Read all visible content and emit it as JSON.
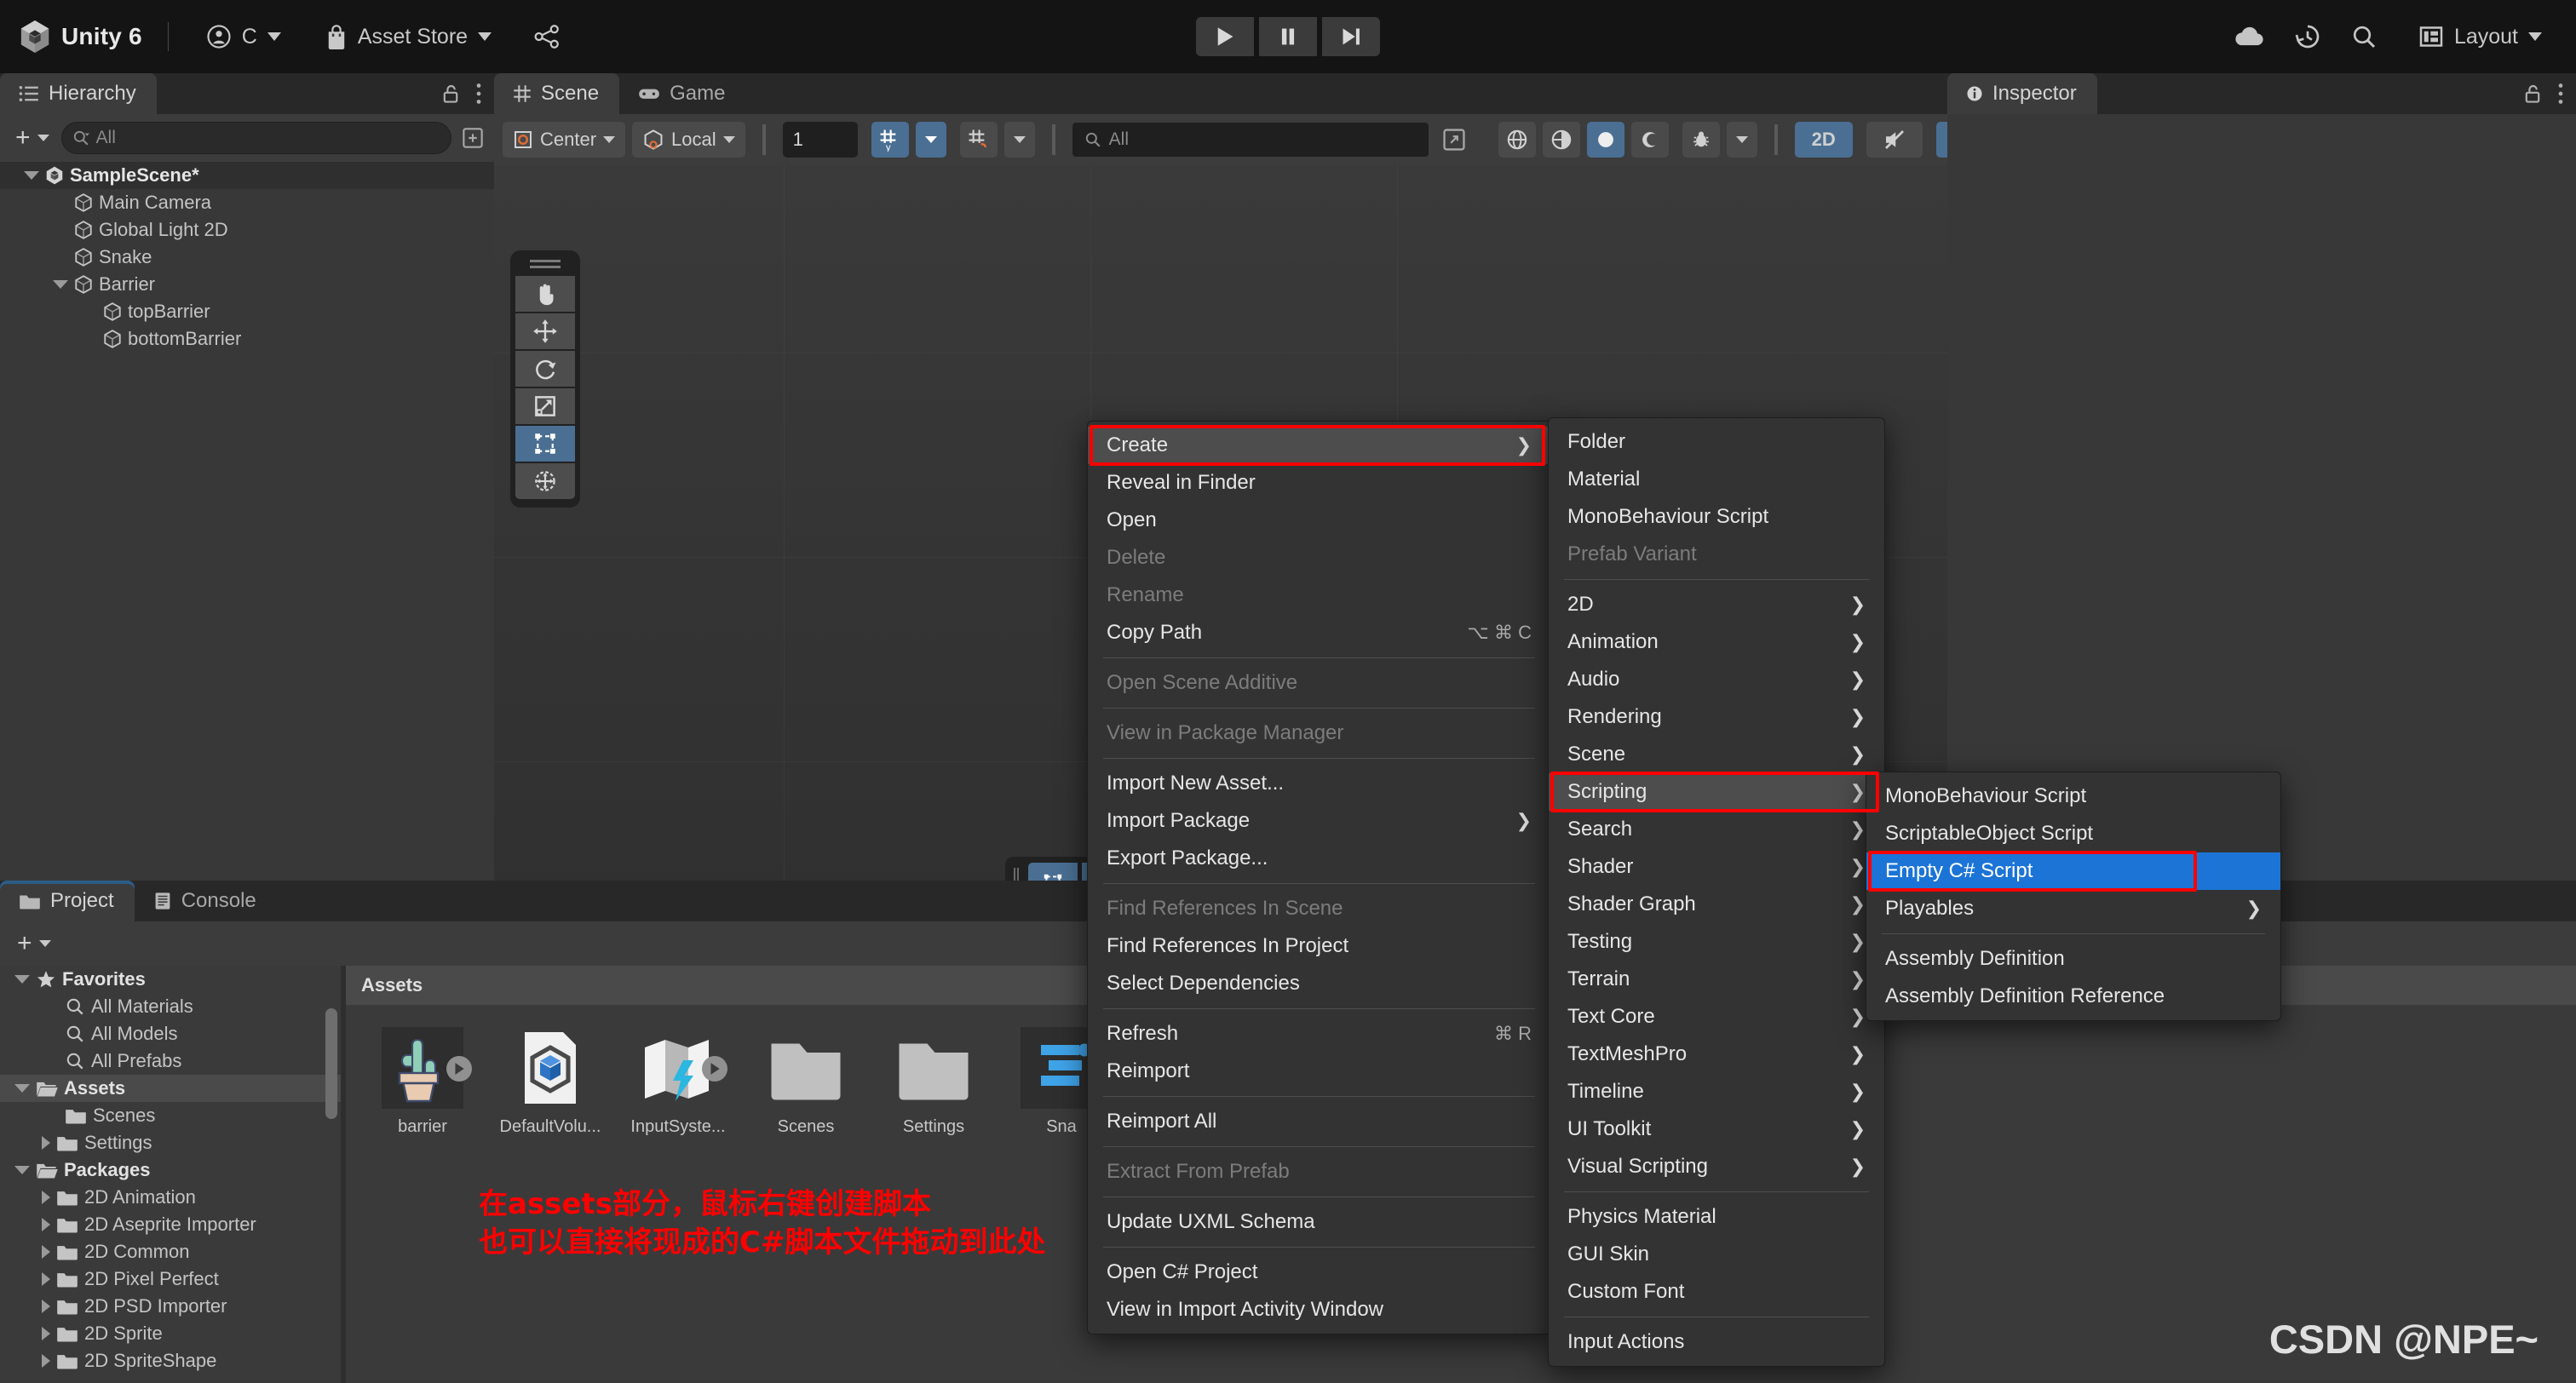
{
  "topbar": {
    "app_title": "Unity 6",
    "account_label": "C",
    "asset_store_label": "Asset Store",
    "icons": {
      "unity_logo": "unity-logo-icon",
      "account": "account-circle-icon",
      "asset_store": "shopping-bag-icon",
      "collab": "version-control-icon",
      "cloud": "cloud-icon",
      "history": "history-clock-icon",
      "search": "search-icon",
      "layout": "layout-grid-icon"
    },
    "play_controls": [
      "play-icon",
      "pause-icon",
      "step-icon"
    ],
    "layout_label": "Layout"
  },
  "hierarchy": {
    "tab_label": "Hierarchy",
    "add_label": "+",
    "search_placeholder": "All",
    "items": [
      {
        "label": "SampleScene*",
        "depth": 0,
        "expanded": true,
        "icon": "unity-scene-icon",
        "selected": true
      },
      {
        "label": "Main Camera",
        "depth": 1,
        "expanded": null,
        "icon": "gameobject-icon",
        "selected": false
      },
      {
        "label": "Global Light 2D",
        "depth": 1,
        "expanded": null,
        "icon": "gameobject-icon",
        "selected": false
      },
      {
        "label": "Snake",
        "depth": 1,
        "expanded": null,
        "icon": "gameobject-icon",
        "selected": false
      },
      {
        "label": "Barrier",
        "depth": 1,
        "expanded": true,
        "icon": "gameobject-icon",
        "selected": false
      },
      {
        "label": "topBarrier",
        "depth": 2,
        "expanded": null,
        "icon": "gameobject-icon",
        "selected": false
      },
      {
        "label": "bottomBarrier",
        "depth": 2,
        "expanded": null,
        "icon": "gameobject-icon",
        "selected": false
      }
    ]
  },
  "sceneview": {
    "tabs": [
      {
        "label": "Scene",
        "icon": "grid-hash-icon",
        "active": true
      },
      {
        "label": "Game",
        "icon": "gamepad-icon",
        "active": false
      }
    ],
    "toolbar": {
      "pivot_label": "Center",
      "space_label": "Local",
      "grid_size_value": "1",
      "search_placeholder": "All",
      "twod_label": "2D",
      "grid_snap_icon": "grid-snap-icon",
      "snap_increment_icon": "snap-increment-icon",
      "gizmos_icon": "gizmos-icon"
    },
    "tools": [
      {
        "name": "hand-tool",
        "selected": false
      },
      {
        "name": "move-tool",
        "selected": false
      },
      {
        "name": "rotate-tool",
        "selected": false
      },
      {
        "name": "scale-tool",
        "selected": false
      },
      {
        "name": "rect-tool",
        "selected": true
      },
      {
        "name": "transform-tool",
        "selected": false
      }
    ],
    "bottom_bar": [
      {
        "name": "rect-overlay",
        "selected": true
      },
      {
        "name": "tool-settings",
        "selected": true
      },
      {
        "name": "grid-visibility",
        "selected": false
      },
      {
        "name": "scene-material",
        "selected": false
      },
      {
        "name": "layers-overlay",
        "selected": true
      },
      {
        "name": "search-overlay",
        "selected": false
      },
      {
        "name": "camera-overlay",
        "selected": false
      },
      {
        "name": "shuffle-overlay",
        "selected": false
      }
    ]
  },
  "inspector": {
    "tab_label": "Inspector",
    "icons": {
      "info": "info-circle-icon",
      "lock": "lock-open-icon",
      "menu": "kebab-menu-icon"
    }
  },
  "project": {
    "tabs": [
      {
        "label": "Project",
        "icon": "folder-icon",
        "active": true
      },
      {
        "label": "Console",
        "icon": "console-icon",
        "active": false
      }
    ],
    "add_label": "+",
    "tree": [
      {
        "label": "Favorites",
        "depth": 0,
        "expand": "down",
        "icon": "star-icon",
        "bold": true,
        "selected": false
      },
      {
        "label": "All Materials",
        "depth": 1,
        "expand": null,
        "icon": "search-icon",
        "bold": false,
        "selected": false
      },
      {
        "label": "All Models",
        "depth": 1,
        "expand": null,
        "icon": "search-icon",
        "bold": false,
        "selected": false
      },
      {
        "label": "All Prefabs",
        "depth": 1,
        "expand": null,
        "icon": "search-icon",
        "bold": false,
        "selected": false
      },
      {
        "label": "Assets",
        "depth": 0,
        "expand": "down",
        "icon": "folder-open-icon",
        "bold": true,
        "selected": true
      },
      {
        "label": "Scenes",
        "depth": 1,
        "expand": null,
        "icon": "folder-icon",
        "bold": false,
        "selected": false
      },
      {
        "label": "Settings",
        "depth": 1,
        "expand": "right",
        "icon": "folder-icon",
        "bold": false,
        "selected": false
      },
      {
        "label": "Packages",
        "depth": 0,
        "expand": "down",
        "icon": "folder-open-icon",
        "bold": true,
        "selected": false
      },
      {
        "label": "2D Animation",
        "depth": 1,
        "expand": "right",
        "icon": "folder-icon",
        "bold": false,
        "selected": false
      },
      {
        "label": "2D Aseprite Importer",
        "depth": 1,
        "expand": "right",
        "icon": "folder-icon",
        "bold": false,
        "selected": false
      },
      {
        "label": "2D Common",
        "depth": 1,
        "expand": "right",
        "icon": "folder-icon",
        "bold": false,
        "selected": false
      },
      {
        "label": "2D Pixel Perfect",
        "depth": 1,
        "expand": "right",
        "icon": "folder-icon",
        "bold": false,
        "selected": false
      },
      {
        "label": "2D PSD Importer",
        "depth": 1,
        "expand": "right",
        "icon": "folder-icon",
        "bold": false,
        "selected": false
      },
      {
        "label": "2D Sprite",
        "depth": 1,
        "expand": "right",
        "icon": "folder-icon",
        "bold": false,
        "selected": false
      },
      {
        "label": "2D SpriteShape",
        "depth": 1,
        "expand": "right",
        "icon": "folder-icon",
        "bold": false,
        "selected": false
      }
    ],
    "breadcrumb": "Assets",
    "assets": [
      {
        "label": "barrier",
        "icon": "cactus-sprite-icon",
        "has_play": true
      },
      {
        "label": "DefaultVolu...",
        "icon": "volume-profile-icon",
        "has_play": false
      },
      {
        "label": "InputSyste...",
        "icon": "input-actions-icon",
        "has_play": true
      },
      {
        "label": "Scenes",
        "icon": "folder-icon",
        "has_play": false
      },
      {
        "label": "Settings",
        "icon": "folder-icon",
        "has_play": false
      },
      {
        "label": "Sna",
        "icon": "snake-sprite-icon",
        "has_play": false
      }
    ]
  },
  "context_menu": {
    "items": [
      {
        "label": "Create",
        "state": "highlight",
        "submenu": true,
        "shortcut": "",
        "redbox": true
      },
      {
        "label": "Reveal in Finder",
        "state": "normal",
        "submenu": false,
        "shortcut": ""
      },
      {
        "label": "Open",
        "state": "normal",
        "submenu": false,
        "shortcut": ""
      },
      {
        "label": "Delete",
        "state": "disabled",
        "submenu": false,
        "shortcut": ""
      },
      {
        "label": "Rename",
        "state": "disabled",
        "submenu": false,
        "shortcut": ""
      },
      {
        "label": "Copy Path",
        "state": "normal",
        "submenu": false,
        "shortcut": "⌥ ⌘ C"
      },
      {
        "separator": true
      },
      {
        "label": "Open Scene Additive",
        "state": "disabled",
        "submenu": false,
        "shortcut": ""
      },
      {
        "separator": true
      },
      {
        "label": "View in Package Manager",
        "state": "disabled",
        "submenu": false,
        "shortcut": ""
      },
      {
        "separator": true
      },
      {
        "label": "Import New Asset...",
        "state": "normal",
        "submenu": false,
        "shortcut": ""
      },
      {
        "label": "Import Package",
        "state": "normal",
        "submenu": true,
        "shortcut": ""
      },
      {
        "label": "Export Package...",
        "state": "normal",
        "submenu": false,
        "shortcut": ""
      },
      {
        "separator": true
      },
      {
        "label": "Find References In Scene",
        "state": "disabled",
        "submenu": false,
        "shortcut": ""
      },
      {
        "label": "Find References In Project",
        "state": "normal",
        "submenu": false,
        "shortcut": ""
      },
      {
        "label": "Select Dependencies",
        "state": "normal",
        "submenu": false,
        "shortcut": ""
      },
      {
        "separator": true
      },
      {
        "label": "Refresh",
        "state": "normal",
        "submenu": false,
        "shortcut": "⌘ R"
      },
      {
        "label": "Reimport",
        "state": "normal",
        "submenu": false,
        "shortcut": ""
      },
      {
        "separator": true
      },
      {
        "label": "Reimport All",
        "state": "normal",
        "submenu": false,
        "shortcut": ""
      },
      {
        "separator": true
      },
      {
        "label": "Extract From Prefab",
        "state": "disabled",
        "submenu": false,
        "shortcut": ""
      },
      {
        "separator": true
      },
      {
        "label": "Update UXML Schema",
        "state": "normal",
        "submenu": false,
        "shortcut": ""
      },
      {
        "separator": true
      },
      {
        "label": "Open C# Project",
        "state": "normal",
        "submenu": false,
        "shortcut": ""
      },
      {
        "label": "View in Import Activity Window",
        "state": "normal",
        "submenu": false,
        "shortcut": ""
      }
    ]
  },
  "create_submenu": {
    "items": [
      {
        "label": "Folder",
        "state": "normal",
        "submenu": false
      },
      {
        "label": "Material",
        "state": "normal",
        "submenu": false
      },
      {
        "label": "MonoBehaviour Script",
        "state": "normal",
        "submenu": false
      },
      {
        "label": "Prefab Variant",
        "state": "disabled",
        "submenu": false
      },
      {
        "separator": true
      },
      {
        "label": "2D",
        "state": "normal",
        "submenu": true
      },
      {
        "label": "Animation",
        "state": "normal",
        "submenu": true
      },
      {
        "label": "Audio",
        "state": "normal",
        "submenu": true
      },
      {
        "label": "Rendering",
        "state": "normal",
        "submenu": true
      },
      {
        "label": "Scene",
        "state": "normal",
        "submenu": true
      },
      {
        "label": "Scripting",
        "state": "highlight",
        "submenu": true,
        "redbox": true
      },
      {
        "label": "Search",
        "state": "normal",
        "submenu": true
      },
      {
        "label": "Shader",
        "state": "normal",
        "submenu": true
      },
      {
        "label": "Shader Graph",
        "state": "normal",
        "submenu": true
      },
      {
        "label": "Testing",
        "state": "normal",
        "submenu": true
      },
      {
        "label": "Terrain",
        "state": "normal",
        "submenu": true
      },
      {
        "label": "Text Core",
        "state": "normal",
        "submenu": true
      },
      {
        "label": "TextMeshPro",
        "state": "normal",
        "submenu": true
      },
      {
        "label": "Timeline",
        "state": "normal",
        "submenu": true
      },
      {
        "label": "UI Toolkit",
        "state": "normal",
        "submenu": true
      },
      {
        "label": "Visual Scripting",
        "state": "normal",
        "submenu": true
      },
      {
        "separator": true
      },
      {
        "label": "Physics Material",
        "state": "normal",
        "submenu": false
      },
      {
        "label": "GUI Skin",
        "state": "normal",
        "submenu": false
      },
      {
        "label": "Custom Font",
        "state": "normal",
        "submenu": false
      },
      {
        "separator": true
      },
      {
        "label": "Input Actions",
        "state": "normal",
        "submenu": false
      }
    ]
  },
  "scripting_submenu": {
    "items": [
      {
        "label": "MonoBehaviour Script",
        "state": "normal",
        "submenu": false
      },
      {
        "label": "ScriptableObject Script",
        "state": "normal",
        "submenu": false
      },
      {
        "label": "Empty C# Script",
        "state": "selected",
        "submenu": false,
        "redbox": true
      },
      {
        "label": "Playables",
        "state": "normal",
        "submenu": true
      },
      {
        "separator": true
      },
      {
        "label": "Assembly Definition",
        "state": "normal",
        "submenu": false
      },
      {
        "label": "Assembly Definition Reference",
        "state": "normal",
        "submenu": false
      }
    ]
  },
  "annotation": {
    "line1": "在assets部分，鼠标右键创建脚本",
    "line2": "也可以直接将现成的C#脚本文件拖动到此处",
    "color": "#ff0000"
  },
  "watermark": {
    "text": "CSDN @NPE~"
  },
  "colors": {
    "accent_blue": "#1b74d6",
    "toolbar_blue": "#4a6f93",
    "panel_bg": "#383838",
    "menu_bg": "#333333",
    "highlight_red": "#ff0000"
  }
}
